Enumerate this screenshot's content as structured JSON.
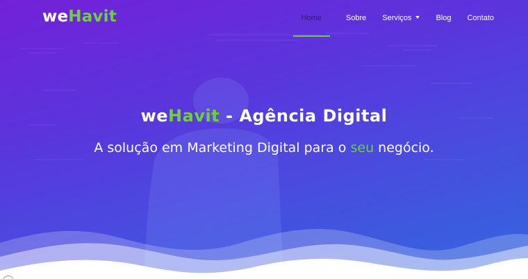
{
  "brand": {
    "logo_prefix": "we",
    "logo_accent": "Havit"
  },
  "nav": {
    "items": [
      {
        "label": "Home",
        "active": true
      },
      {
        "label": "Sobre"
      },
      {
        "label": "Serviços",
        "has_dropdown": true
      },
      {
        "label": "Blog"
      },
      {
        "label": "Contato"
      }
    ],
    "active_indicator_color": "#6fcf3f"
  },
  "hero": {
    "headline_prefix": "we",
    "headline_accent": "Havit",
    "headline_rest": " - Agência Digital",
    "subheadline_before": "A solução em Marketing Digital para o ",
    "subheadline_accent": "seu",
    "subheadline_after": " negócio."
  },
  "colors": {
    "accent_green": "#6fcf3f",
    "gradient_top": "#7321d9",
    "gradient_bottom": "#3168dd",
    "text": "#ffffff"
  },
  "icons": {
    "dropdown": "caret-down-icon"
  }
}
